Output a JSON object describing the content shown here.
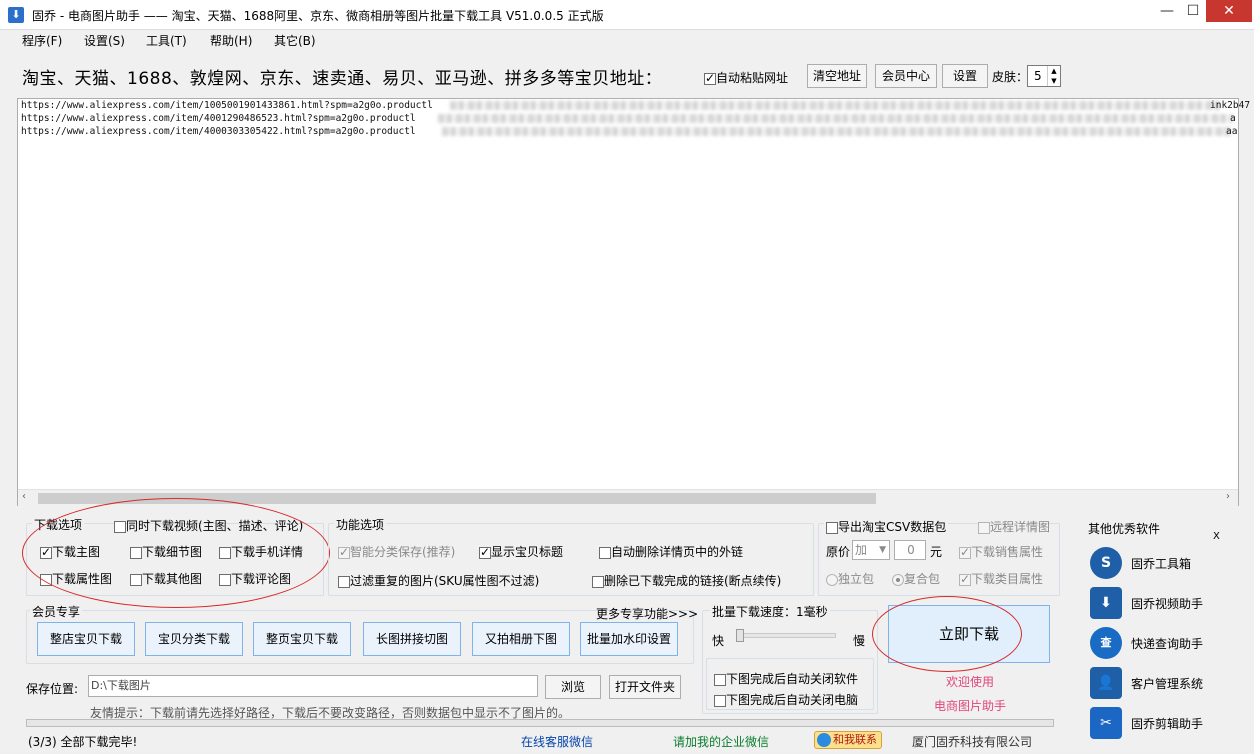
{
  "window": {
    "title": "固乔 - 电商图片助手 —— 淘宝、天猫、1688阿里、京东、微商相册等图片批量下载工具 V51.0.0.5 正式版",
    "icon": "download-app-icon",
    "minimize": "—",
    "maximize": "☐",
    "close": "✕"
  },
  "menu": [
    "程序(F)",
    "设置(S)",
    "工具(T)",
    "帮助(H)",
    "其它(B)"
  ],
  "url_bar": {
    "label": "淘宝、天猫、1688、敦煌网、京东、速卖通、易贝、亚马逊、拼多多等宝贝地址：",
    "auto_paste": {
      "label": "自动粘贴网址",
      "checked": true
    },
    "clear_button": "清空地址",
    "member_button": "会员中心",
    "settings_button": "设置",
    "skin_label": "皮肤：",
    "skin_value": "5"
  },
  "urls": [
    "https://www.aliexpress.com/item/1005001901433861.html?spm=a2g0o.productl",
    "https://www.aliexpress.com/item/4001290486523.html?spm=a2g0o.productl",
    "https://www.aliexpress.com/item/4000303305422.html?spm=a2g0o.productl"
  ],
  "url_tail": [
    "ink2b47",
    "a",
    "aa"
  ],
  "download_options": {
    "legend": "下载选项",
    "video": {
      "label": "同时下载视频(主图、描述、评论)",
      "checked": false
    },
    "items": [
      {
        "label": "下载主图",
        "checked": true
      },
      {
        "label": "下载细节图",
        "checked": false
      },
      {
        "label": "下载手机详情",
        "checked": false
      },
      {
        "label": "下载属性图",
        "checked": false
      },
      {
        "label": "下载其他图",
        "checked": false
      },
      {
        "label": "下载评论图",
        "checked": false
      }
    ]
  },
  "function_options": {
    "legend": "功能选项",
    "smart_save": {
      "label": "智能分类保存(推荐)",
      "checked": true,
      "disabled": true
    },
    "show_title": {
      "label": "显示宝贝标题",
      "checked": true
    },
    "remove_links": {
      "label": "自动删除详情页中的外链",
      "checked": false
    },
    "filter_dup": {
      "label": "过滤重复的图片(SKU属性图不过滤)",
      "checked": false
    },
    "delete_done": {
      "label": "删除已下载完成的链接(断点续传)",
      "checked": false
    }
  },
  "csv": {
    "export": {
      "label": "导出淘宝CSV数据包",
      "checked": false
    },
    "remote": {
      "label": "远程详情图",
      "checked": false
    },
    "price_label": "原价",
    "price_op": "加",
    "price_value": "0",
    "price_unit": "元",
    "sales_attr": {
      "label": "下载销售属性",
      "checked": true
    },
    "single": "独立包",
    "combined": "复合包",
    "category_attr": {
      "label": "下载类目属性",
      "checked": true
    }
  },
  "member": {
    "legend": "会员专享",
    "more": "更多专享功能>>>",
    "buttons": [
      "整店宝贝下载",
      "宝贝分类下载",
      "整页宝贝下载",
      "长图拼接切图",
      "又拍相册下图",
      "批量加水印设置"
    ]
  },
  "speed": {
    "legend": "批量下载速度：1毫秒",
    "fast": "快",
    "slow": "慢",
    "level": 0
  },
  "after_done": {
    "close_app": {
      "label": "下图完成后自动关闭软件",
      "checked": false
    },
    "shutdown": {
      "label": "下图完成后自动关闭电脑",
      "checked": false
    }
  },
  "download_button": "立即下载",
  "welcome": "欢迎使用",
  "brand": "电商图片助手",
  "save": {
    "label": "保存位置:",
    "path": "D:\\下载图片",
    "browse": "浏览",
    "open_folder": "打开文件夹"
  },
  "tip": "友情提示：下载前请先选择好路径，下载后不要改变路径，否则数据包中显示不了图片的。",
  "progress": 0,
  "status": {
    "done": "(3/3) 全部下载完毕!",
    "wechat_service": "在线客服微信",
    "enterprise_wechat": "请加我的企业微信",
    "contact": "和我联系",
    "company": "厦门固乔科技有限公司"
  },
  "sidebar": {
    "title": "其他优秀软件",
    "close": "X",
    "items": [
      {
        "label": "固乔工具箱",
        "icon": "toolbox-icon",
        "glyph": "S"
      },
      {
        "label": "固乔视频助手",
        "icon": "video-download-icon",
        "glyph": "⬇"
      },
      {
        "label": "快递查询助手",
        "icon": "express-search-icon",
        "glyph": "查"
      },
      {
        "label": "客户管理系统",
        "icon": "customer-icon",
        "glyph": "👤"
      },
      {
        "label": "固乔剪辑助手",
        "icon": "scissors-icon",
        "glyph": "✂"
      }
    ]
  },
  "colors": {
    "accent_blue": "#2a6fc9",
    "annotation_red": "#d62a2a",
    "link_blue": "#0645ad",
    "link_green": "#0a7d2c",
    "brand_pink": "#e0457b"
  }
}
